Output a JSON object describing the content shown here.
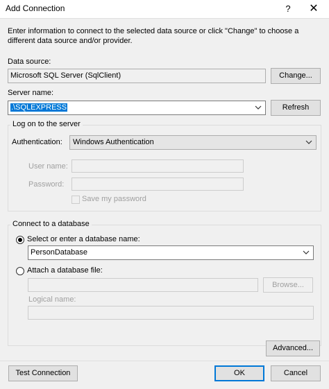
{
  "window": {
    "title": "Add Connection",
    "help_glyph": "?",
    "close_glyph": "✕"
  },
  "intro": "Enter information to connect to the selected data source or click \"Change\" to choose a different data source and/or provider.",
  "data_source": {
    "label": "Data source:",
    "value": "Microsoft SQL Server (SqlClient)",
    "change_button": "Change..."
  },
  "server": {
    "label": "Server name:",
    "value": ".\\SQLEXPRESS",
    "refresh_button": "Refresh"
  },
  "logon": {
    "legend": "Log on to the server",
    "auth_label": "Authentication:",
    "auth_value": "Windows Authentication",
    "username_label": "User name:",
    "password_label": "Password:",
    "save_password_label": "Save my password"
  },
  "database": {
    "legend": "Connect to a database",
    "select_option_label": "Select or enter a database name:",
    "database_value": "PersonDatabase",
    "attach_option_label": "Attach a database file:",
    "browse_button": "Browse...",
    "logical_name_label": "Logical name:"
  },
  "footer": {
    "advanced_button": "Advanced...",
    "test_button": "Test Connection",
    "ok_button": "OK",
    "cancel_button": "Cancel"
  },
  "colors": {
    "accent": "#0078d7",
    "dialog_background": "#f0f0f0",
    "disabled_text": "#a0a0a0"
  }
}
